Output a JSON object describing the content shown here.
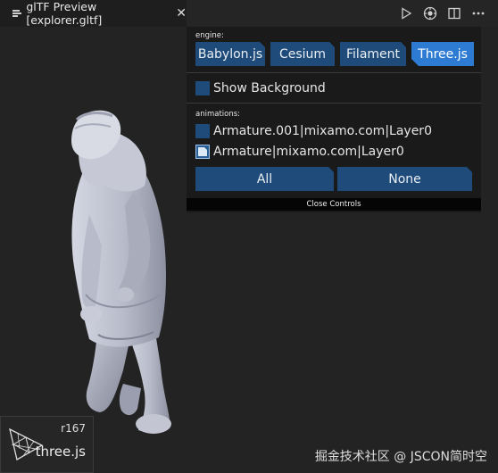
{
  "tab": {
    "title": "glTF Preview [explorer.gltf]",
    "close": "✕"
  },
  "toolbar": {
    "icons": [
      "play-icon",
      "debug-icon",
      "split-editor-icon",
      "more-icon"
    ]
  },
  "controls": {
    "engine_label": "engine:",
    "engines": [
      {
        "label": "Babylon.js",
        "active": false
      },
      {
        "label": "Cesium",
        "active": false
      },
      {
        "label": "Filament",
        "active": false
      },
      {
        "label": "Three.js",
        "active": true
      }
    ],
    "show_background": {
      "label": "Show Background",
      "checked": false
    },
    "animations_label": "animations:",
    "animations": [
      {
        "label": "Armature.001|mixamo.com|Layer0",
        "checked": false
      },
      {
        "label": "Armature|mixamo.com|Layer0",
        "checked": true
      }
    ],
    "all_label": "All",
    "none_label": "None",
    "close_label": "Close Controls"
  },
  "badge": {
    "version": "r167",
    "name": "three.js"
  },
  "watermark": "掘金技术社区 @ JSCON简时空"
}
